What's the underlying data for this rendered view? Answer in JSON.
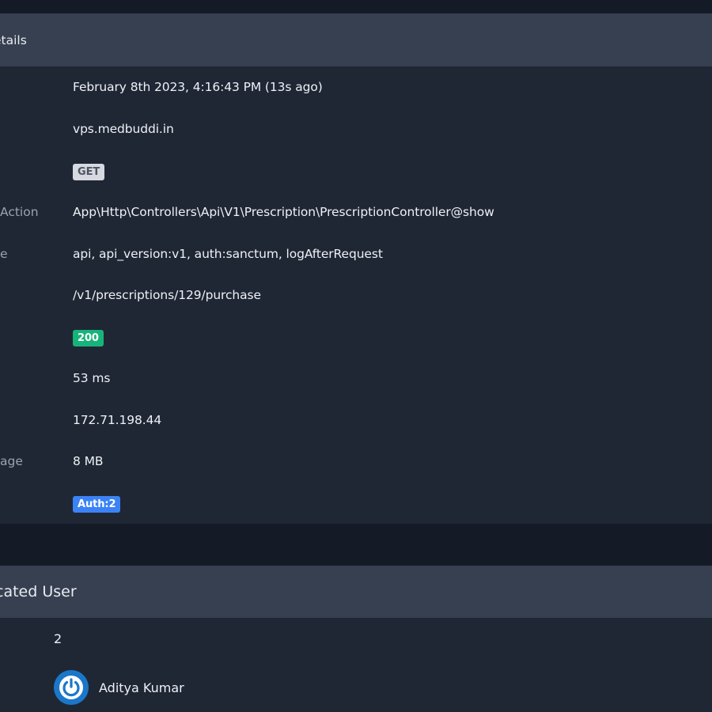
{
  "details": {
    "title": "Request Details",
    "title_visible": "etails",
    "rows": [
      {
        "label": "",
        "value": "February 8th 2023, 4:16:43 PM (13s ago)"
      },
      {
        "label": "",
        "value": "vps.medbuddi.in"
      },
      {
        "label": "",
        "value": "GET"
      },
      {
        "label": "Action",
        "value": "App\\Http\\Controllers\\Api\\V1\\Prescription\\PrescriptionController@show"
      },
      {
        "label": "e",
        "value": "api, api_version:v1, auth:sanctum, logAfterRequest"
      },
      {
        "label": "",
        "value": "/v1/prescriptions/129/purchase"
      },
      {
        "label": "",
        "value": "200"
      },
      {
        "label": "",
        "value": "53 ms"
      },
      {
        "label": "",
        "value": "172.71.198.44"
      },
      {
        "label": "age",
        "value": "8 MB"
      },
      {
        "label": "",
        "value": "Auth:2"
      }
    ]
  },
  "user": {
    "title_visible": "cated User",
    "id": "2",
    "name": "Aditya Kumar"
  },
  "colors": {
    "background": "#141b27",
    "card": "#1f2735",
    "card_header": "#374051",
    "status_ok": "#18b37a",
    "tag": "#3b82f6",
    "avatar": "#1b77c9"
  },
  "icons": {
    "avatar": "power-icon"
  }
}
